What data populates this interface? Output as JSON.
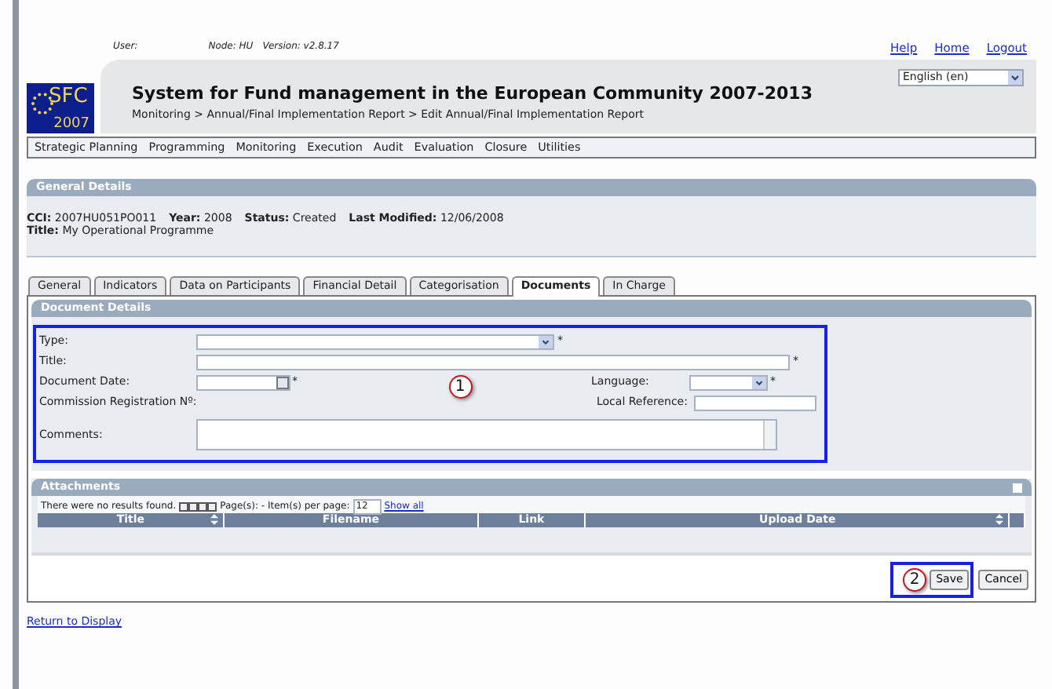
{
  "user_bar": {
    "user_label": "User:",
    "node": "Node: HU",
    "version": "Version: v2.8.17"
  },
  "top_links": [
    "Help",
    "Home",
    "Logout"
  ],
  "header": {
    "title": "System for Fund management in the European Community 2007-2013",
    "breadcrumb": "Monitoring > Annual/Final Implementation Report > Edit Annual/Final Implementation Report",
    "logo_text": "SFC",
    "logo_year": "2007",
    "language": "English (en)"
  },
  "menu": [
    "Strategic Planning",
    "Programming",
    "Monitoring",
    "Execution",
    "Audit",
    "Evaluation",
    "Closure",
    "Utilities"
  ],
  "general_details": {
    "heading": "General Details",
    "fields": [
      {
        "label": "CCI:",
        "value": "2007HU051PO011"
      },
      {
        "label": "Year:",
        "value": "2008"
      },
      {
        "label": "Status:",
        "value": "Created"
      },
      {
        "label": "Last Modified:",
        "value": "12/06/2008"
      }
    ],
    "title_label": "Title:",
    "title_value": "My Operational Programme"
  },
  "tabs": [
    {
      "label": "General",
      "selected": false
    },
    {
      "label": "Indicators",
      "selected": false
    },
    {
      "label": "Data on Participants",
      "selected": false
    },
    {
      "label": "Financial Detail",
      "selected": false
    },
    {
      "label": "Categorisation",
      "selected": false
    },
    {
      "label": "Documents",
      "selected": true
    },
    {
      "label": "In Charge",
      "selected": false
    }
  ],
  "document_details": {
    "heading": "Document Details",
    "callout": "1",
    "fields": [
      {
        "label": "Type:",
        "kind": "select",
        "required": true
      },
      {
        "label": "Title:",
        "kind": "text",
        "required": true
      },
      {
        "label": "Document Date:",
        "kind": "date",
        "required": true
      },
      {
        "label": "Commission Registration Nº:",
        "kind": "none",
        "required": false
      },
      {
        "label": "Comments:",
        "kind": "textarea",
        "required": false
      }
    ],
    "side_fields": [
      {
        "label": "Language:",
        "kind": "select",
        "required": true
      },
      {
        "label": "Local Reference:",
        "kind": "text",
        "required": false
      }
    ],
    "required_mark": "*"
  },
  "attachments": {
    "heading": "Attachments",
    "message": "There were no results found.",
    "pages_label": "Page(s): - Item(s) per page:",
    "per_page": "12",
    "show_all": "Show all",
    "columns": [
      {
        "label": "Title",
        "sortable": true
      },
      {
        "label": "Filename",
        "sortable": false
      },
      {
        "label": "Link",
        "sortable": false
      },
      {
        "label": "Upload Date",
        "sortable": true
      }
    ]
  },
  "save_callout": "2",
  "buttons": [
    "Save",
    "Cancel"
  ],
  "return_link": "Return to Display"
}
